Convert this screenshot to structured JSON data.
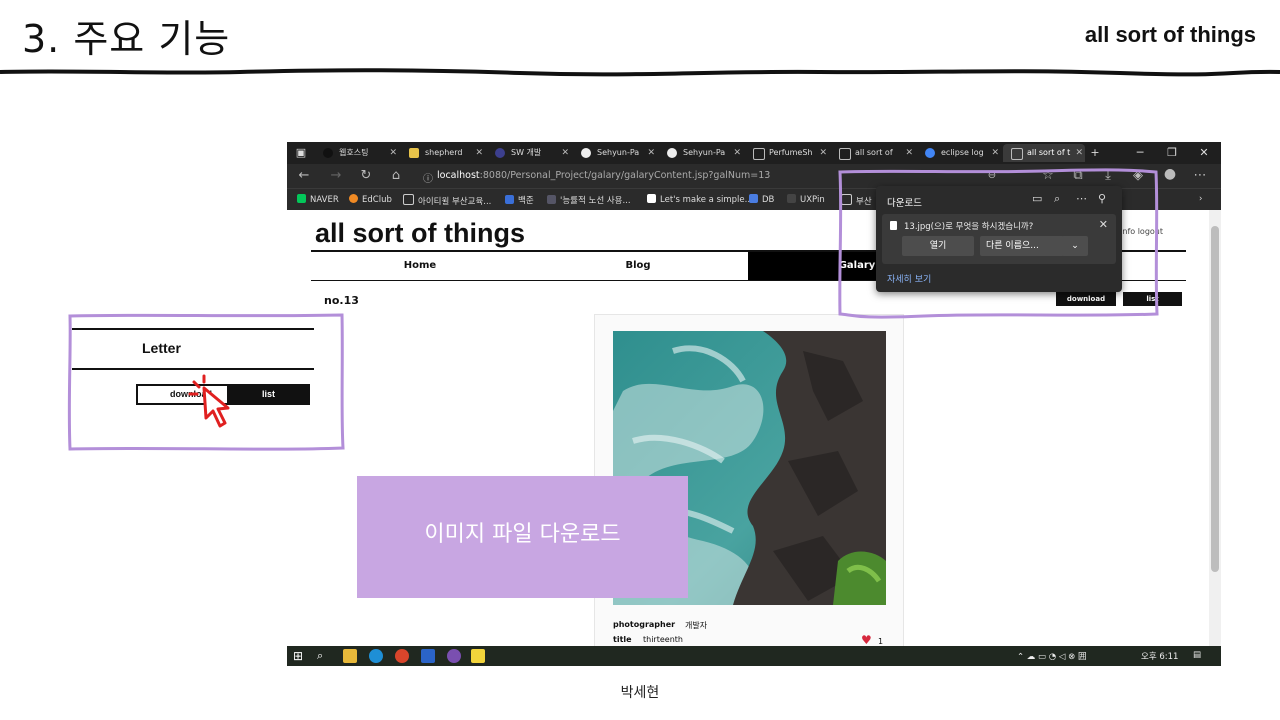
{
  "slide": {
    "title": "3. 주요 기능",
    "brand": "all sort of things",
    "footer": "박세현"
  },
  "browser": {
    "tabs": [
      "웹호스팅",
      "shepherd",
      "SW 개발",
      "Sehyun-Pa",
      "Sehyun-Pa",
      "PerfumeSh",
      "all sort of",
      "eclipse log",
      "all sort of t"
    ],
    "url_host": "localhost",
    "url_path": ":8080/Personal_Project/galary/galaryContent.jsp?galNum=13",
    "bookmarks": [
      "NAVER",
      "EdClub",
      "아이티윌 부산교육...",
      "백준",
      "'능률적 노선 사용...",
      "Let's make a simple...",
      "DB",
      "UXPin",
      "부산"
    ]
  },
  "site": {
    "title": "all sort of things",
    "top_links": "님 info logout",
    "nav": [
      "Home",
      "Blog",
      "Galary"
    ],
    "post_no": "no.13",
    "download_label": "download",
    "list_label": "list",
    "photographer_label": "photographer",
    "photographer_value": "개발자",
    "title_label": "title",
    "title_value": "thirteenth",
    "likes": "1"
  },
  "download_popup": {
    "title": "다운로드",
    "file_prompt": "13.jpg(으)로 무엇을 하시겠습니까?",
    "open_label": "열기",
    "saveas_label": "다른 이름으...",
    "more_label": "자세히 보기"
  },
  "taskbar": {
    "time": "오후 6:11"
  },
  "callout": {
    "letter": "Letter",
    "download": "download",
    "list": "list"
  },
  "banner": {
    "text": "이미지 파일 다운로드"
  },
  "colors": {
    "highlight": "#c8a6e2",
    "outline": "#b38fd9",
    "cursor": "#e02020"
  }
}
